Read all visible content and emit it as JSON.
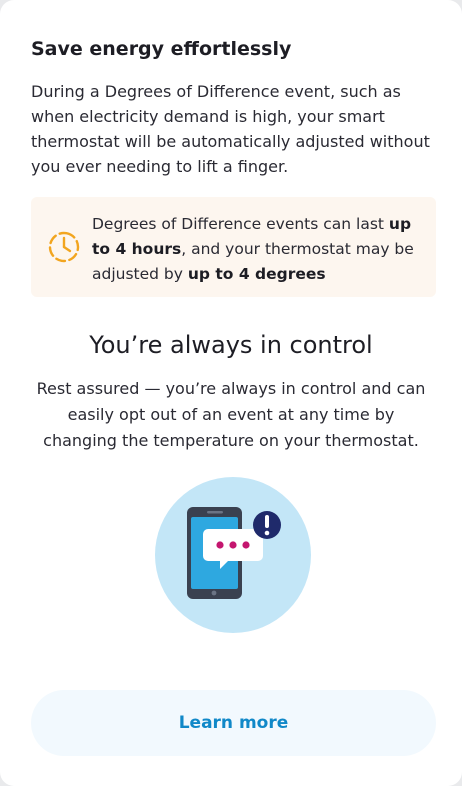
{
  "card": {
    "title": "Save energy effortlessly",
    "intro": "During a Degrees of Difference event, such as when electricity demand is high, your smart thermostat will be automatically adjusted without you ever needing to lift a finger.",
    "callout": {
      "icon": "timer-clock-icon",
      "text_part1": "Degrees of Difference events can last ",
      "bold1": "up to 4 hours",
      "text_part2": ", and your thermostat may be adjusted by ",
      "bold2": "up to 4 degrees"
    },
    "control_heading": "You’re always in control",
    "control_body": "Rest assured — you’re always in control and can easily opt out of an event at any time by changing the temperature on your thermostat.",
    "illustration": {
      "icon": "phone-notification-icon"
    },
    "learn_more_label": "Learn more"
  },
  "colors": {
    "accent": "#1088c8",
    "callout_bg": "#fdf6ef",
    "clock_orange": "#f2a51f",
    "illustration_circle": "#c3e6f7",
    "phone_screen": "#2ea8e0",
    "dots_magenta": "#c4166f",
    "alert_navy": "#1f2a6b"
  }
}
